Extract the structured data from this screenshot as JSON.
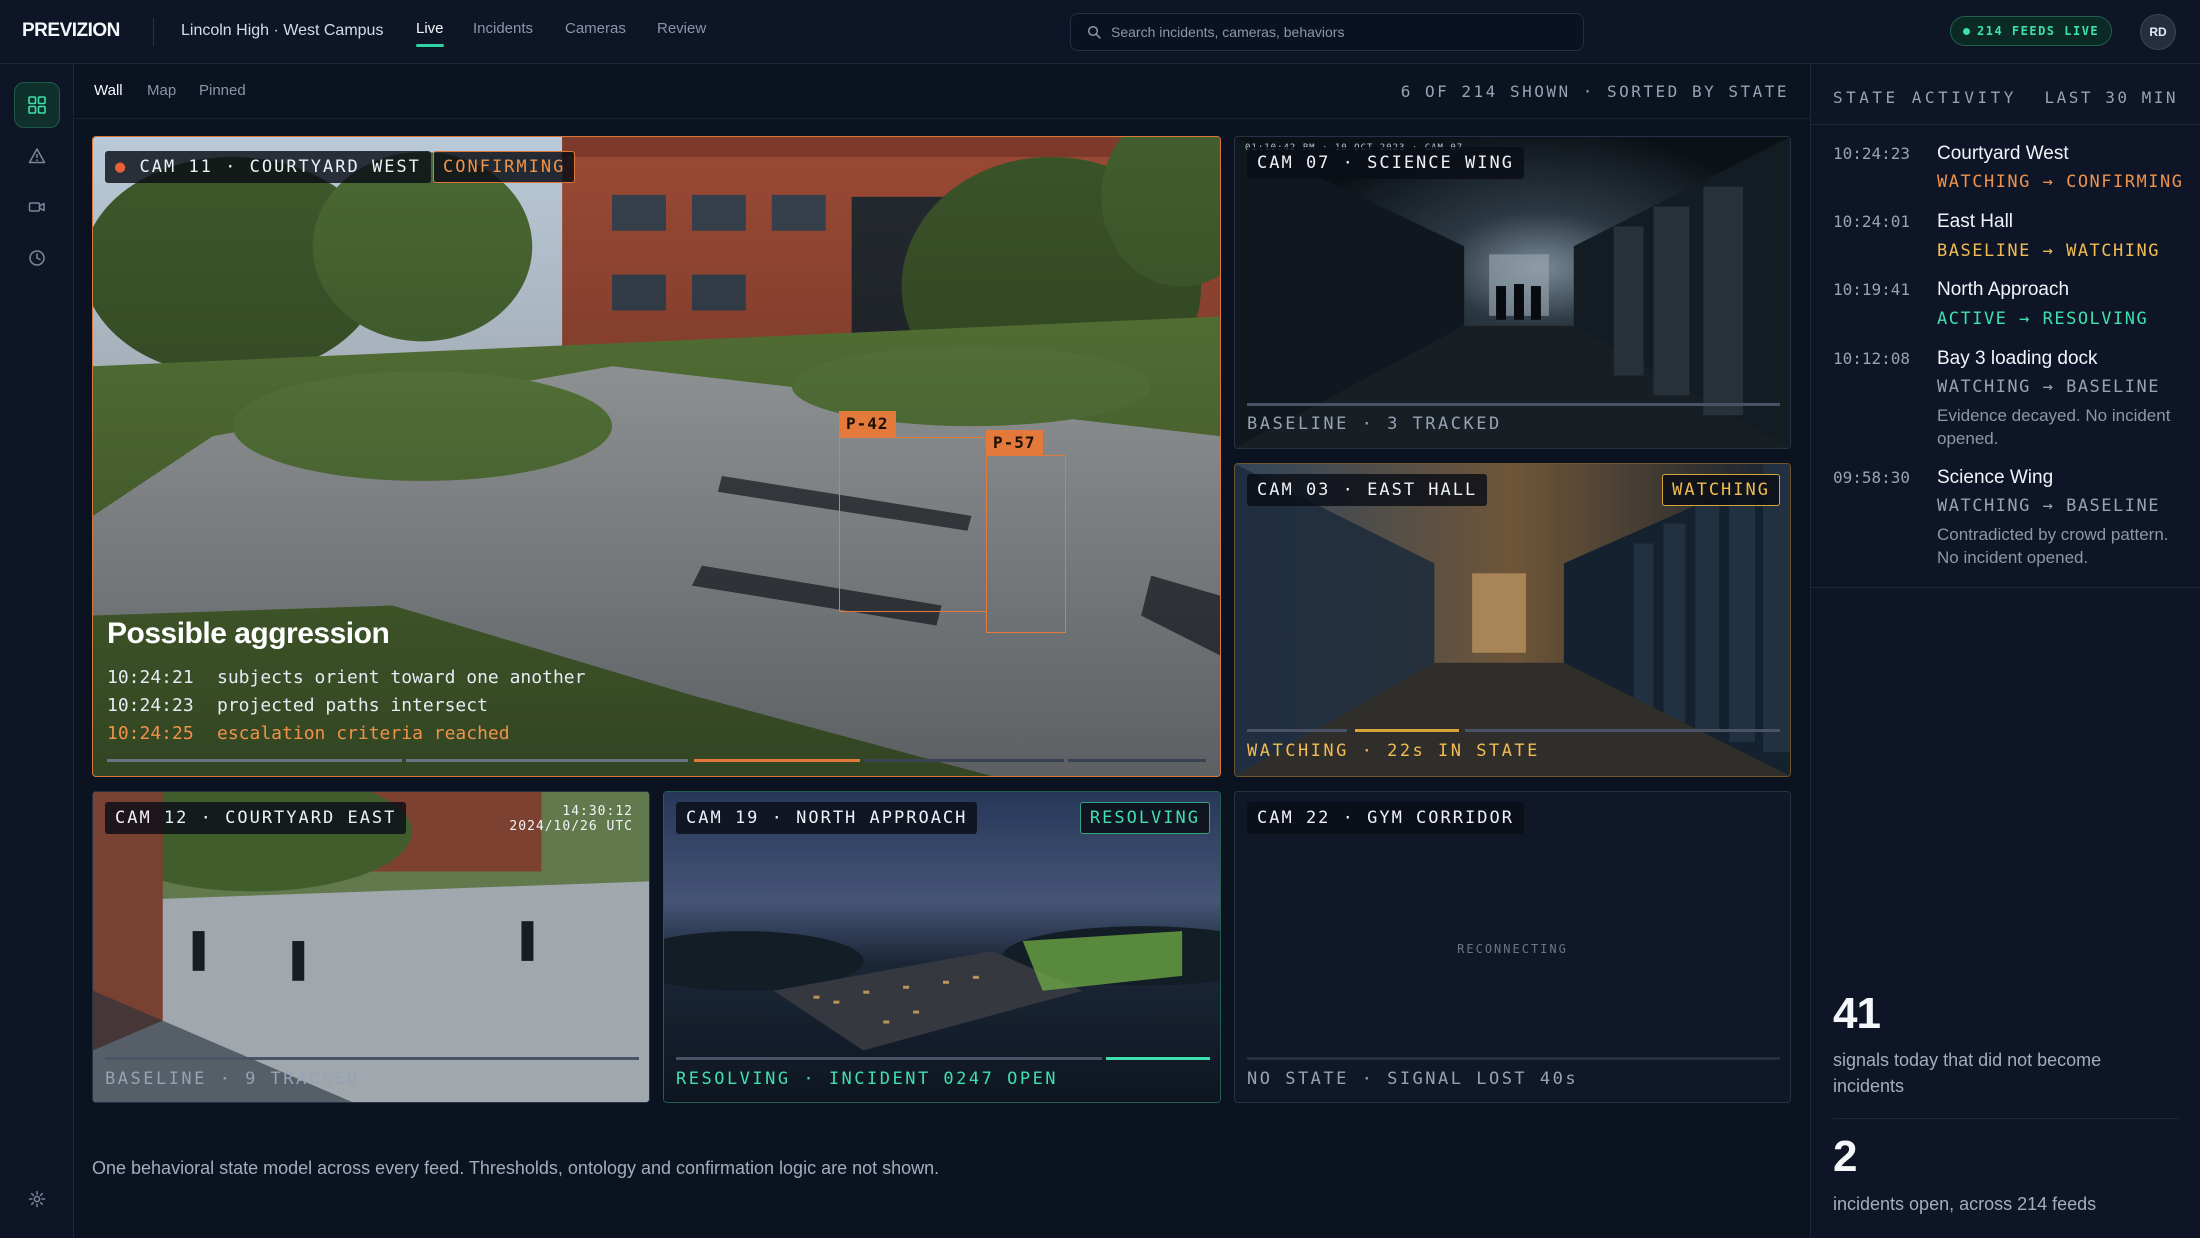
{
  "app": {
    "brand": "PREVIZION",
    "campus": "Lincoln High · West Campus",
    "nav": [
      {
        "label": "Live"
      },
      {
        "label": "Incidents"
      },
      {
        "label": "Cameras"
      },
      {
        "label": "Review"
      }
    ],
    "search_placeholder": "Search incidents, cameras, behaviors",
    "feeds_live": "214 FEEDS LIVE",
    "user_initials": "RD"
  },
  "colors": {
    "accent": "#2fd3a2",
    "confirming": "#f0924a",
    "watching": "#f1bc52",
    "resolving": "#3fe0ad",
    "baseline": "#98a2b3"
  },
  "rail_icons": [
    "grid-icon",
    "alert-triangle-icon",
    "video-icon",
    "clock-icon",
    "settings-icon"
  ],
  "subheader": {
    "tabs": [
      {
        "label": "Wall"
      },
      {
        "label": "Map"
      },
      {
        "label": "Pinned"
      }
    ],
    "shown": "6 OF 214 SHOWN · SORTED BY STATE"
  },
  "feeds": {
    "cam11": {
      "label": "CAM 11 · COURTYARD WEST",
      "state": "CONFIRMING",
      "tracks": [
        {
          "id": "P-42"
        },
        {
          "id": "P-57"
        }
      ],
      "headline": "Possible aggression",
      "log": [
        {
          "time": "10:24:21",
          "text": "subjects orient toward one another"
        },
        {
          "time": "10:24:23",
          "text": "projected paths intersect"
        },
        {
          "time": "10:24:25",
          "text": "escalation criteria reached"
        }
      ]
    },
    "cam07": {
      "label": "CAM 07 · SCIENCE WING",
      "footer": "BASELINE · 3 TRACKED",
      "overlay": "01:10:42 PM · 10 OCT 2023 · CAM 07"
    },
    "cam03": {
      "label": "CAM 03 · EAST HALL",
      "state": "WATCHING",
      "footer": "WATCHING · 22s IN STATE"
    },
    "cam12": {
      "label": "CAM 12 · COURTYARD EAST",
      "timestamp_time": "14:30:12",
      "timestamp_date": "2024/10/26 UTC",
      "footer": "BASELINE · 9 TRACKED"
    },
    "cam19": {
      "label": "CAM 19 · NORTH APPROACH",
      "state": "RESOLVING",
      "footer": "RESOLVING · INCIDENT 0247 OPEN"
    },
    "cam22": {
      "label": "CAM 22 · GYM CORRIDOR",
      "status": "RECONNECTING",
      "footer": "NO STATE · SIGNAL LOST 40s"
    }
  },
  "caption": "One behavioral state model across every feed. Thresholds, ontology and confirmation logic are not shown.",
  "activity": {
    "title": "STATE ACTIVITY",
    "range": "LAST 30 MIN",
    "items": [
      {
        "time": "10:24:23",
        "place": "Courtyard West",
        "transition": "WATCHING → CONFIRMING",
        "color": "#f0924a",
        "note": ""
      },
      {
        "time": "10:24:01",
        "place": "East Hall",
        "transition": "BASELINE → WATCHING",
        "color": "#f1bc52",
        "note": ""
      },
      {
        "time": "10:19:41",
        "place": "North Approach",
        "transition": "ACTIVE → RESOLVING",
        "color": "#3fe0ad",
        "note": ""
      },
      {
        "time": "10:12:08",
        "place": "Bay 3 loading dock",
        "transition": "WATCHING → BASELINE",
        "color": "#98a2b3",
        "note": "Evidence decayed. No incident opened."
      },
      {
        "time": "09:58:30",
        "place": "Science Wing",
        "transition": "WATCHING → BASELINE",
        "color": "#98a2b3",
        "note": "Contradicted by crowd pattern. No incident opened."
      }
    ]
  },
  "stats": [
    {
      "value": "41",
      "label": "signals today that did not become incidents"
    },
    {
      "value": "2",
      "label": "incidents open, across 214 feeds"
    }
  ]
}
